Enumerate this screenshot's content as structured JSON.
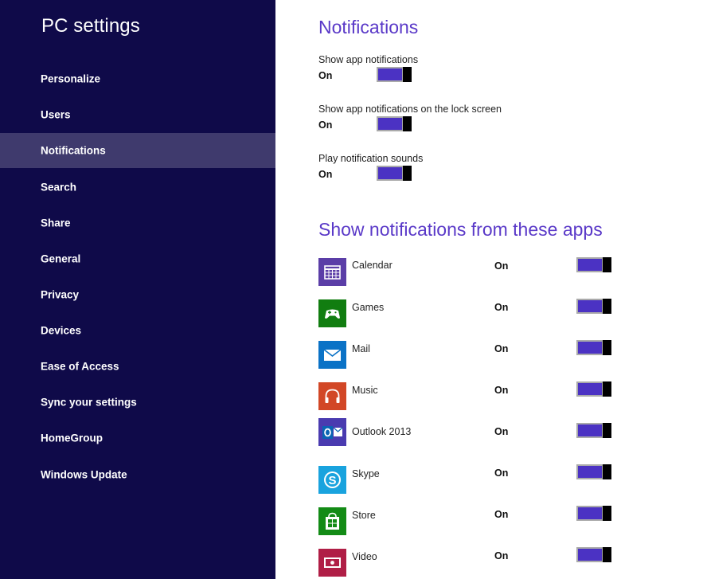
{
  "sidebar": {
    "title": "PC settings",
    "items": [
      {
        "label": "Personalize"
      },
      {
        "label": "Users"
      },
      {
        "label": "Notifications",
        "selected": true
      },
      {
        "label": "Search"
      },
      {
        "label": "Share"
      },
      {
        "label": "General"
      },
      {
        "label": "Privacy"
      },
      {
        "label": "Devices"
      },
      {
        "label": "Ease of Access"
      },
      {
        "label": "Sync your settings"
      },
      {
        "label": "HomeGroup"
      },
      {
        "label": "Windows Update"
      }
    ]
  },
  "main": {
    "notifications_heading": "Notifications",
    "settings": [
      {
        "label": "Show app notifications",
        "state": "On",
        "toggle_on": true
      },
      {
        "label": "Show app notifications on the lock screen",
        "state": "On",
        "toggle_on": true
      },
      {
        "label": "Play notification sounds",
        "state": "On",
        "toggle_on": true
      }
    ],
    "apps_heading": "Show notifications from these apps",
    "apps": [
      {
        "name": "Calendar",
        "state": "On",
        "toggle_on": true,
        "icon": "calendar-icon",
        "color": "#5b3ea7"
      },
      {
        "name": "Games",
        "state": "On",
        "toggle_on": true,
        "icon": "xbox-controller-icon",
        "color": "#117d10"
      },
      {
        "name": "Mail",
        "state": "On",
        "toggle_on": true,
        "icon": "envelope-icon",
        "color": "#0a72c6"
      },
      {
        "name": "Music",
        "state": "On",
        "toggle_on": true,
        "icon": "headphones-icon",
        "color": "#d24726"
      },
      {
        "name": "Outlook 2013",
        "state": "On",
        "toggle_on": true,
        "icon": "outlook-icon",
        "color": "#4a3bb0"
      },
      {
        "name": "Skype",
        "state": "On",
        "toggle_on": true,
        "icon": "skype-icon",
        "color": "#19a3de"
      },
      {
        "name": "Store",
        "state": "On",
        "toggle_on": true,
        "icon": "shopping-bag-icon",
        "color": "#138b16"
      },
      {
        "name": "Video",
        "state": "On",
        "toggle_on": true,
        "icon": "video-icon",
        "color": "#b01e46"
      }
    ]
  },
  "colors": {
    "sidebar_bg": "#0f0a49",
    "selected_bg": "#3f3a6d",
    "heading": "#5a39c8",
    "toggle_on": "#4b32c3"
  }
}
